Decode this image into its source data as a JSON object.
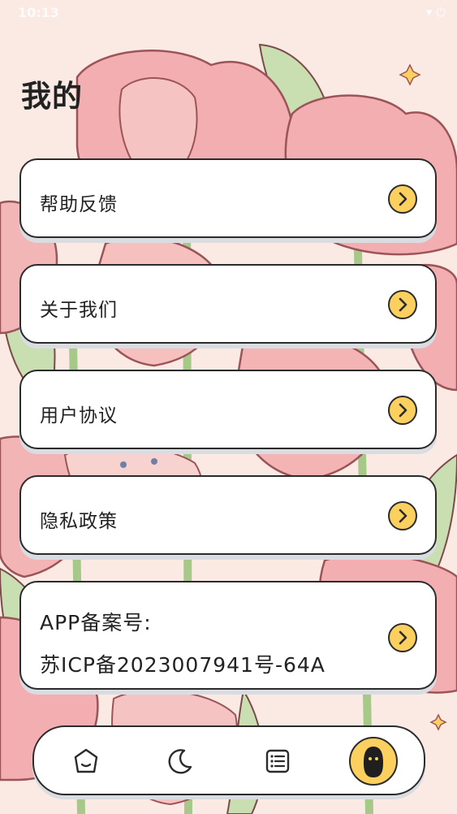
{
  "status_bar": {
    "time": "10:13",
    "icons": "▾ ⏻"
  },
  "page": {
    "title": "我的"
  },
  "menu": {
    "help_feedback": "帮助反馈",
    "about_us": "关于我们",
    "user_agreement": "用户协议",
    "privacy_policy": "隐私政策",
    "icp_label": "APP备案号:",
    "icp_number": "苏ICP备2023007941号-64A"
  },
  "icons": {
    "arrow": "chevron-right-icon",
    "nav": [
      "home-icon",
      "moon-icon",
      "list-icon",
      "profile-icon"
    ]
  },
  "colors": {
    "accent": "#fcd05f",
    "card": "#ffffff",
    "outline": "#2b2b2b"
  }
}
